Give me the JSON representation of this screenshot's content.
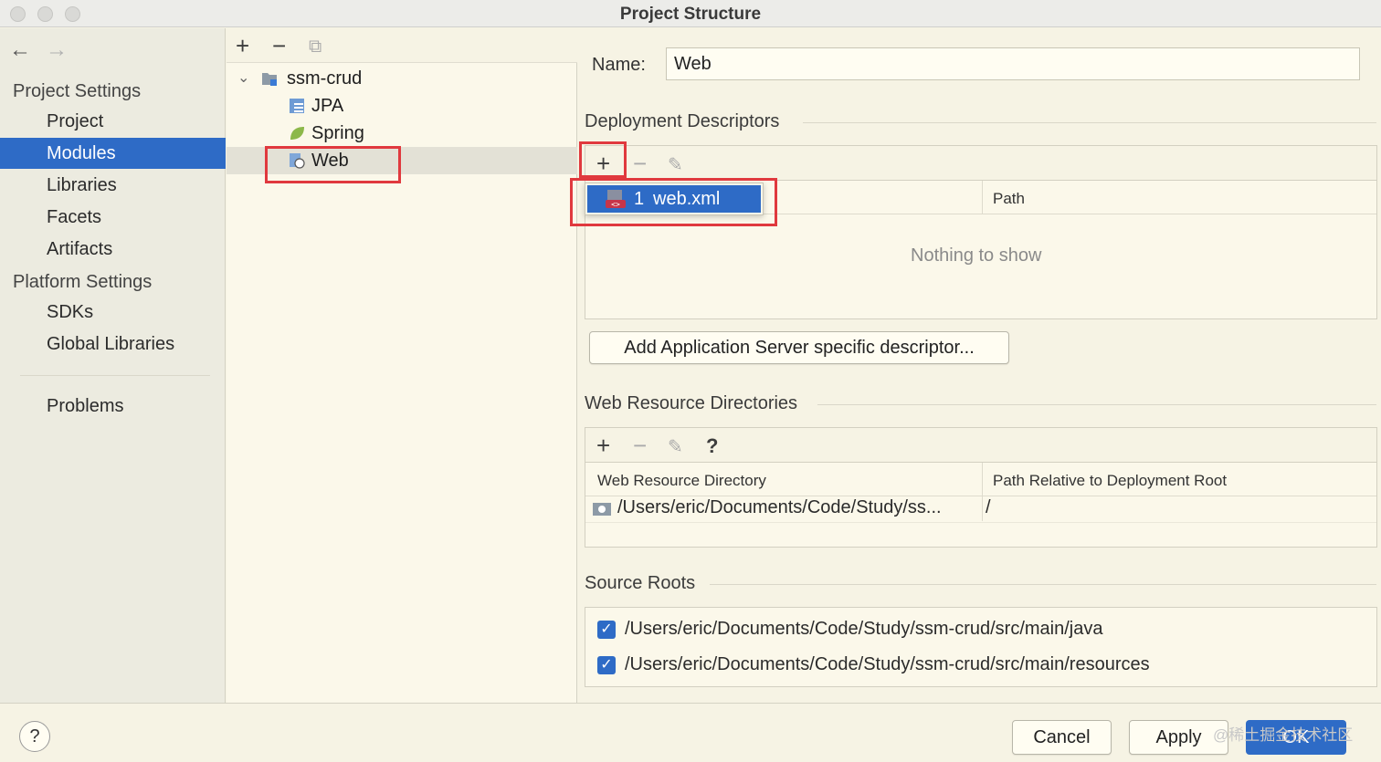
{
  "window": {
    "title": "Project Structure"
  },
  "nav": {
    "back_icon": "arrow-left-icon",
    "forward_icon": "arrow-right-icon",
    "project_settings_header": "Project Settings",
    "platform_settings_header": "Platform Settings",
    "project_items": [
      "Project",
      "Modules",
      "Libraries",
      "Facets",
      "Artifacts"
    ],
    "platform_items": [
      "SDKs",
      "Global Libraries"
    ],
    "problems": "Problems",
    "selected": "Modules"
  },
  "tree": {
    "toolbar": [
      "plus-icon",
      "minus-icon",
      "copy-icon"
    ],
    "root": "ssm-crud",
    "children": [
      "JPA",
      "Spring",
      "Web"
    ],
    "selected": "Web"
  },
  "details": {
    "name_label": "Name:",
    "name_value": "Web",
    "deployment_title": "Deployment Descriptors",
    "deployment_columns": [
      "",
      "Path"
    ],
    "deployment_empty": "Nothing to show",
    "add_descriptor_button": "Add Application Server specific descriptor...",
    "popup_item_number": "1",
    "popup_item_label": "web.xml",
    "web_resource_title": "Web Resource Directories",
    "web_resource_columns": [
      "Web Resource Directory",
      "Path Relative to Deployment Root"
    ],
    "web_resource_rows": [
      {
        "directory": "/Users/eric/Documents/Code/Study/ss...",
        "relative": "/"
      }
    ],
    "help_glyph": "?",
    "source_roots_title": "Source Roots",
    "source_roots": [
      {
        "path": "/Users/eric/Documents/Code/Study/ssm-crud/src/main/java",
        "checked": true
      },
      {
        "path": "/Users/eric/Documents/Code/Study/ssm-crud/src/main/resources",
        "checked": true
      }
    ]
  },
  "footer": {
    "help": "?",
    "cancel": "Cancel",
    "apply": "Apply",
    "ok": "OK",
    "watermark": "@稀土掘金技术社区"
  },
  "colors": {
    "accent": "#2e6bc6",
    "highlight_box": "#e0393e",
    "background": "#f6f3e4"
  }
}
